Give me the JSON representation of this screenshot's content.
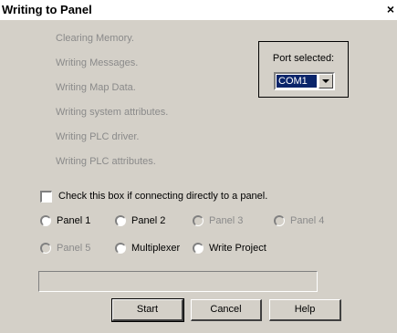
{
  "window": {
    "title": "Writing to Panel",
    "close_glyph": "×"
  },
  "steps": [
    "Clearing Memory.",
    "Writing Messages.",
    "Writing Map Data.",
    "Writing system attributes.",
    "Writing PLC driver.",
    "Writing PLC attributes."
  ],
  "port": {
    "label": "Port selected:",
    "selected": "COM1"
  },
  "direct_checkbox": {
    "label": "Check this box if connecting directly to a panel.",
    "checked": false
  },
  "radios": [
    {
      "label": "Panel 1",
      "enabled": true
    },
    {
      "label": "Panel 2",
      "enabled": true
    },
    {
      "label": "Panel 3",
      "enabled": false
    },
    {
      "label": "Panel 4",
      "enabled": false
    },
    {
      "label": "Panel 5",
      "enabled": false
    },
    {
      "label": "Multiplexer",
      "enabled": true
    },
    {
      "label": "Write Project",
      "enabled": true
    }
  ],
  "progress": {
    "value": 0
  },
  "buttons": {
    "start": "Start",
    "cancel": "Cancel",
    "help": "Help"
  },
  "colors": {
    "dialog_bg": "#d4d0c8",
    "disabled_text": "#8a8a8a",
    "selection_bg": "#0a246a"
  }
}
